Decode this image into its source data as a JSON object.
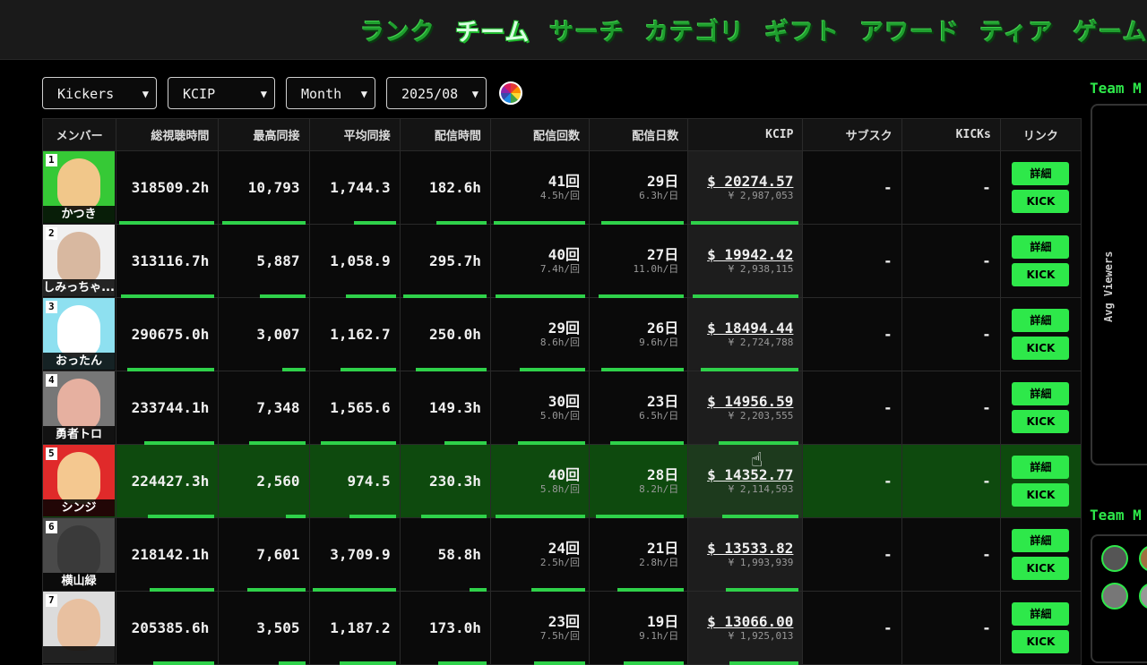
{
  "nav": [
    "ランク",
    "チーム",
    "サーチ",
    "カテゴリ",
    "ギフト",
    "アワード",
    "ティア",
    "ゲーム"
  ],
  "nav_active": "チーム",
  "filters": {
    "team": "Kickers",
    "metric": "KCIP",
    "period": "Month",
    "date": "2025/08"
  },
  "columns": [
    "メンバー",
    "総視聴時間",
    "最高同接",
    "平均同接",
    "配信時間",
    "配信回数",
    "配信日数",
    "KCIP",
    "サブスク",
    "KICKs",
    "リンク"
  ],
  "buttons": {
    "detail": "詳細",
    "kick": "KICK"
  },
  "rows": [
    {
      "rank": "1",
      "name": "かつき",
      "total": "318509.2h",
      "peak": "10,793",
      "avg": "1,744.3",
      "time": "182.6h",
      "count": "41回",
      "count_sub": "4.5h/回",
      "days": "29日",
      "days_sub": "6.3h/日",
      "usd": "$ 20274.57",
      "jpy": "¥ 2,987,053",
      "subs": "-",
      "kicks": "-",
      "highlight": false,
      "bars": [
        1,
        1,
        0.5,
        0.6,
        1,
        0.9,
        1
      ]
    },
    {
      "rank": "2",
      "name": "しみっちゃ...",
      "total": "313116.7h",
      "peak": "5,887",
      "avg": "1,058.9",
      "time": "295.7h",
      "count": "40回",
      "count_sub": "7.4h/回",
      "days": "27日",
      "days_sub": "11.0h/日",
      "usd": "$ 19942.42",
      "jpy": "¥ 2,938,115",
      "subs": "-",
      "kicks": "-",
      "highlight": false,
      "bars": [
        0.98,
        0.55,
        0.6,
        1,
        0.98,
        0.93,
        0.98
      ]
    },
    {
      "rank": "3",
      "name": "おったん",
      "total": "290675.0h",
      "peak": "3,007",
      "avg": "1,162.7",
      "time": "250.0h",
      "count": "29回",
      "count_sub": "8.6h/回",
      "days": "26日",
      "days_sub": "9.6h/日",
      "usd": "$ 18494.44",
      "jpy": "¥ 2,724,788",
      "subs": "-",
      "kicks": "-",
      "highlight": false,
      "bars": [
        0.91,
        0.28,
        0.67,
        0.85,
        0.71,
        0.9,
        0.91
      ]
    },
    {
      "rank": "4",
      "name": "勇者トロ",
      "total": "233744.1h",
      "peak": "7,348",
      "avg": "1,565.6",
      "time": "149.3h",
      "count": "30回",
      "count_sub": "5.0h/回",
      "days": "23日",
      "days_sub": "6.5h/日",
      "usd": "$ 14956.59",
      "jpy": "¥ 2,203,555",
      "subs": "-",
      "kicks": "-",
      "highlight": false,
      "bars": [
        0.73,
        0.68,
        0.9,
        0.5,
        0.73,
        0.8,
        0.74
      ]
    },
    {
      "rank": "5",
      "name": "シンジ",
      "total": "224427.3h",
      "peak": "2,560",
      "avg": "974.5",
      "time": "230.3h",
      "count": "40回",
      "count_sub": "5.8h/回",
      "days": "28日",
      "days_sub": "8.2h/日",
      "usd": "$ 14352.77",
      "jpy": "¥ 2,114,593",
      "subs": "-",
      "kicks": "-",
      "highlight": true,
      "bars": [
        0.7,
        0.24,
        0.56,
        0.78,
        0.98,
        0.96,
        0.71
      ]
    },
    {
      "rank": "6",
      "name": "横山緑",
      "total": "218142.1h",
      "peak": "7,601",
      "avg": "3,709.9",
      "time": "58.8h",
      "count": "24回",
      "count_sub": "2.5h/回",
      "days": "21日",
      "days_sub": "2.8h/日",
      "usd": "$ 13533.82",
      "jpy": "¥ 1,993,939",
      "subs": "-",
      "kicks": "-",
      "highlight": false,
      "bars": [
        0.68,
        0.7,
        1,
        0.2,
        0.59,
        0.72,
        0.67
      ]
    },
    {
      "rank": "7",
      "name": "",
      "total": "205385.6h",
      "peak": "3,505",
      "avg": "1,187.2",
      "time": "173.0h",
      "count": "23回",
      "count_sub": "7.5h/回",
      "days": "19日",
      "days_sub": "9.1h/日",
      "usd": "$ 13066.00",
      "jpy": "¥ 1,925,013",
      "subs": "-",
      "kicks": "-",
      "highlight": false,
      "bars": [
        0.64,
        0.32,
        0.68,
        0.58,
        0.56,
        0.66,
        0.64
      ]
    }
  ],
  "side": {
    "title1": "Team M",
    "title2": "Team M",
    "axis_label": "Avg Viewers"
  },
  "colors": {
    "accent": "#2ee84a",
    "highlight_row": "#0e4a0e"
  }
}
